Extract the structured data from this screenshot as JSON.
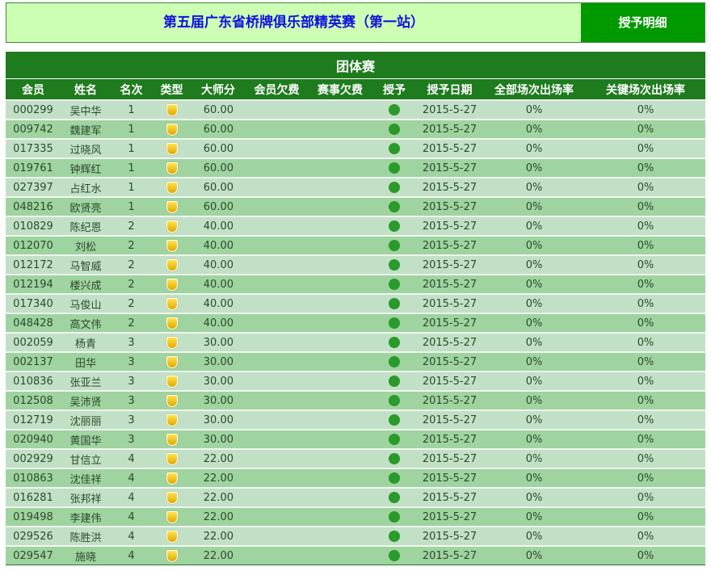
{
  "header": {
    "title": "第五届广东省桥牌俱乐部精英赛（第一站）",
    "detail_button": "授予明细"
  },
  "table": {
    "caption": "团体赛",
    "columns": [
      "会员",
      "姓名",
      "名次",
      "类型",
      "大师分",
      "会员欠费",
      "赛事欠费",
      "授予",
      "授予日期",
      "全部场次出场率",
      "关键场次出场率"
    ],
    "rows": [
      [
        "000299",
        "吴中华",
        "1",
        "60.00",
        "2015-5-27",
        "0%",
        "0%"
      ],
      [
        "009742",
        "魏建军",
        "1",
        "60.00",
        "2015-5-27",
        "0%",
        "0%"
      ],
      [
        "017335",
        "过晓风",
        "1",
        "60.00",
        "2015-5-27",
        "0%",
        "0%"
      ],
      [
        "019761",
        "钟辉红",
        "1",
        "60.00",
        "2015-5-27",
        "0%",
        "0%"
      ],
      [
        "027397",
        "占红水",
        "1",
        "60.00",
        "2015-5-27",
        "0%",
        "0%"
      ],
      [
        "048216",
        "欧贤亮",
        "1",
        "60.00",
        "2015-5-27",
        "0%",
        "0%"
      ],
      [
        "010829",
        "陈纪恩",
        "2",
        "40.00",
        "2015-5-27",
        "0%",
        "0%"
      ],
      [
        "012070",
        "刘松",
        "2",
        "40.00",
        "2015-5-27",
        "0%",
        "0%"
      ],
      [
        "012172",
        "马智威",
        "2",
        "40.00",
        "2015-5-27",
        "0%",
        "0%"
      ],
      [
        "012194",
        "楼兴成",
        "2",
        "40.00",
        "2015-5-27",
        "0%",
        "0%"
      ],
      [
        "017340",
        "马俊山",
        "2",
        "40.00",
        "2015-5-27",
        "0%",
        "0%"
      ],
      [
        "048428",
        "高文伟",
        "2",
        "40.00",
        "2015-5-27",
        "0%",
        "0%"
      ],
      [
        "002059",
        "杨青",
        "3",
        "30.00",
        "2015-5-27",
        "0%",
        "0%"
      ],
      [
        "002137",
        "田华",
        "3",
        "30.00",
        "2015-5-27",
        "0%",
        "0%"
      ],
      [
        "010836",
        "张亚兰",
        "3",
        "30.00",
        "2015-5-27",
        "0%",
        "0%"
      ],
      [
        "012508",
        "吴沛贤",
        "3",
        "30.00",
        "2015-5-27",
        "0%",
        "0%"
      ],
      [
        "012719",
        "沈丽丽",
        "3",
        "30.00",
        "2015-5-27",
        "0%",
        "0%"
      ],
      [
        "020940",
        "黄国华",
        "3",
        "30.00",
        "2015-5-27",
        "0%",
        "0%"
      ],
      [
        "002929",
        "甘信立",
        "4",
        "22.00",
        "2015-5-27",
        "0%",
        "0%"
      ],
      [
        "010863",
        "沈佳祥",
        "4",
        "22.00",
        "2015-5-27",
        "0%",
        "0%"
      ],
      [
        "016281",
        "张邦祥",
        "4",
        "22.00",
        "2015-5-27",
        "0%",
        "0%"
      ],
      [
        "019498",
        "李建伟",
        "4",
        "22.00",
        "2015-5-27",
        "0%",
        "0%"
      ],
      [
        "029526",
        "陈胜洪",
        "4",
        "22.00",
        "2015-5-27",
        "0%",
        "0%"
      ],
      [
        "029547",
        "施晓",
        "4",
        "22.00",
        "2015-5-27",
        "0%",
        "0%"
      ]
    ],
    "type_icon": "gold-shield-icon",
    "grant_icon": "green-dot-icon"
  }
}
